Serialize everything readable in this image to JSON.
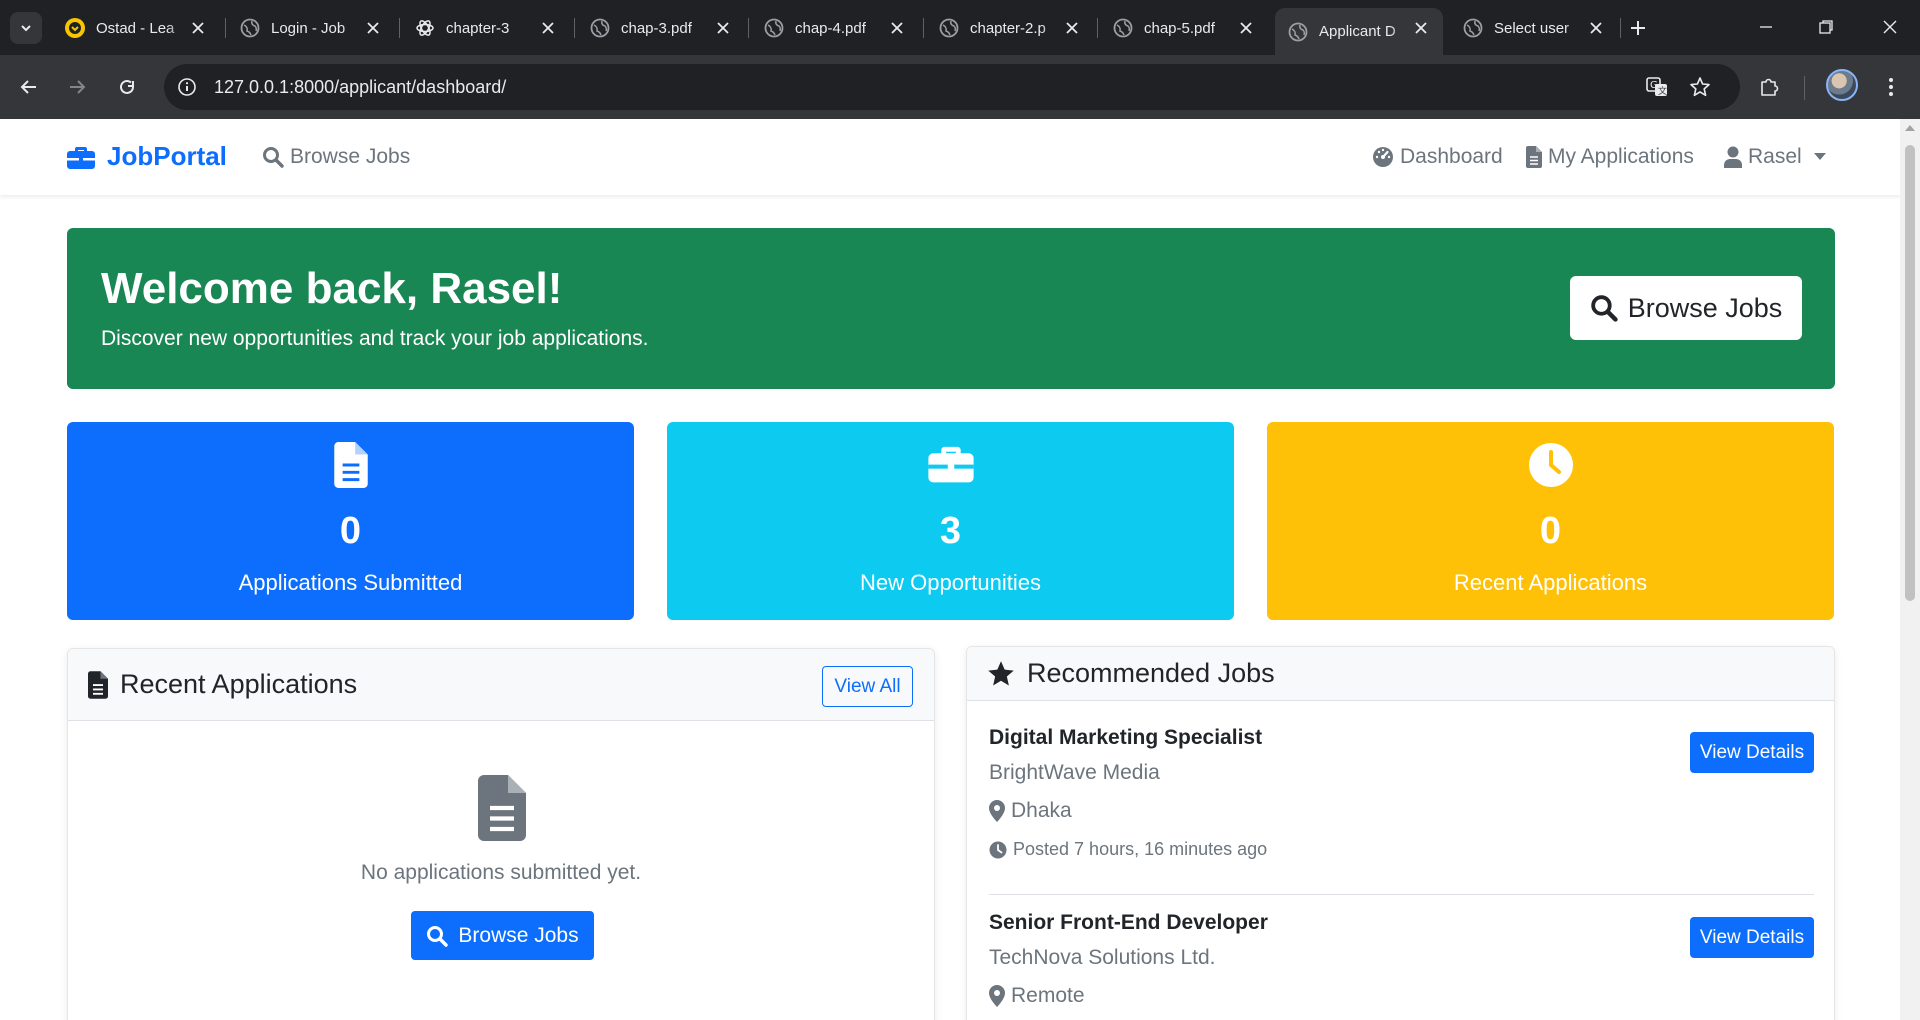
{
  "browser": {
    "tabs": [
      {
        "title": "Ostad - Lea",
        "icon": "ostad-favicon-icon",
        "active": false
      },
      {
        "title": "Login - Job",
        "icon": "globe-icon",
        "active": false
      },
      {
        "title": "chapter-3",
        "icon": "chatgpt-icon",
        "active": false
      },
      {
        "title": "chap-3.pdf",
        "icon": "globe-icon",
        "active": false
      },
      {
        "title": "chap-4.pdf",
        "icon": "globe-icon",
        "active": false
      },
      {
        "title": "chapter-2.p",
        "icon": "globe-icon",
        "active": false
      },
      {
        "title": "chap-5.pdf",
        "icon": "globe-icon",
        "active": false
      },
      {
        "title": "Applicant D",
        "icon": "globe-icon",
        "active": true
      },
      {
        "title": "Select user",
        "icon": "globe-icon",
        "active": false
      }
    ],
    "url": "127.0.0.1:8000/applicant/dashboard/"
  },
  "nav": {
    "brand": "JobPortal",
    "browse_jobs": "Browse Jobs",
    "dashboard": "Dashboard",
    "my_applications": "My Applications",
    "user": "Rasel"
  },
  "hero": {
    "title": "Welcome back, Rasel!",
    "subtitle": "Discover new opportunities and track your job applications.",
    "button": "Browse Jobs"
  },
  "stats": [
    {
      "value": "0",
      "label": "Applications Submitted",
      "color": "#0d6efd",
      "icon": "file-icon"
    },
    {
      "value": "3",
      "label": "New Opportunities",
      "color": "#0dcaf0",
      "icon": "briefcase-icon"
    },
    {
      "value": "0",
      "label": "Recent Applications",
      "color": "#ffc107",
      "icon": "clock-icon"
    }
  ],
  "recent_applications": {
    "title": "Recent Applications",
    "view_all": "View All",
    "empty_text": "No applications submitted yet.",
    "browse_button": "Browse Jobs"
  },
  "recommended_jobs": {
    "title": "Recommended Jobs",
    "jobs": [
      {
        "title": "Digital Marketing Specialist",
        "company": "BrightWave Media",
        "location": "Dhaka",
        "posted": "Posted 7 hours, 16 minutes ago",
        "button": "View Details"
      },
      {
        "title": "Senior Front-End Developer",
        "company": "TechNova Solutions Ltd.",
        "location": "Remote",
        "button": "View Details"
      }
    ]
  },
  "colors": {
    "primary": "#0d6efd",
    "success": "#198754",
    "info": "#0dcaf0",
    "warning": "#ffc107",
    "muted": "#6c757d"
  }
}
